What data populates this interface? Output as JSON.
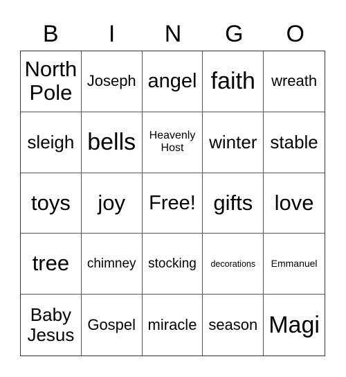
{
  "header": {
    "letters": [
      "B",
      "I",
      "N",
      "G",
      "O"
    ]
  },
  "board": {
    "rows": [
      [
        "North\nPole",
        "Joseph",
        "angel",
        "faith",
        "wreath"
      ],
      [
        "sleigh",
        "bells",
        "Heavenly\nHost",
        "winter",
        "stable"
      ],
      [
        "toys",
        "joy",
        "Free!",
        "gifts",
        "love"
      ],
      [
        "tree",
        "chimney",
        "stocking",
        "decorations",
        "Emmanuel"
      ],
      [
        "Baby\nJesus",
        "Gospel",
        "miracle",
        "season",
        "Magi"
      ]
    ],
    "free_space": "Free!"
  }
}
